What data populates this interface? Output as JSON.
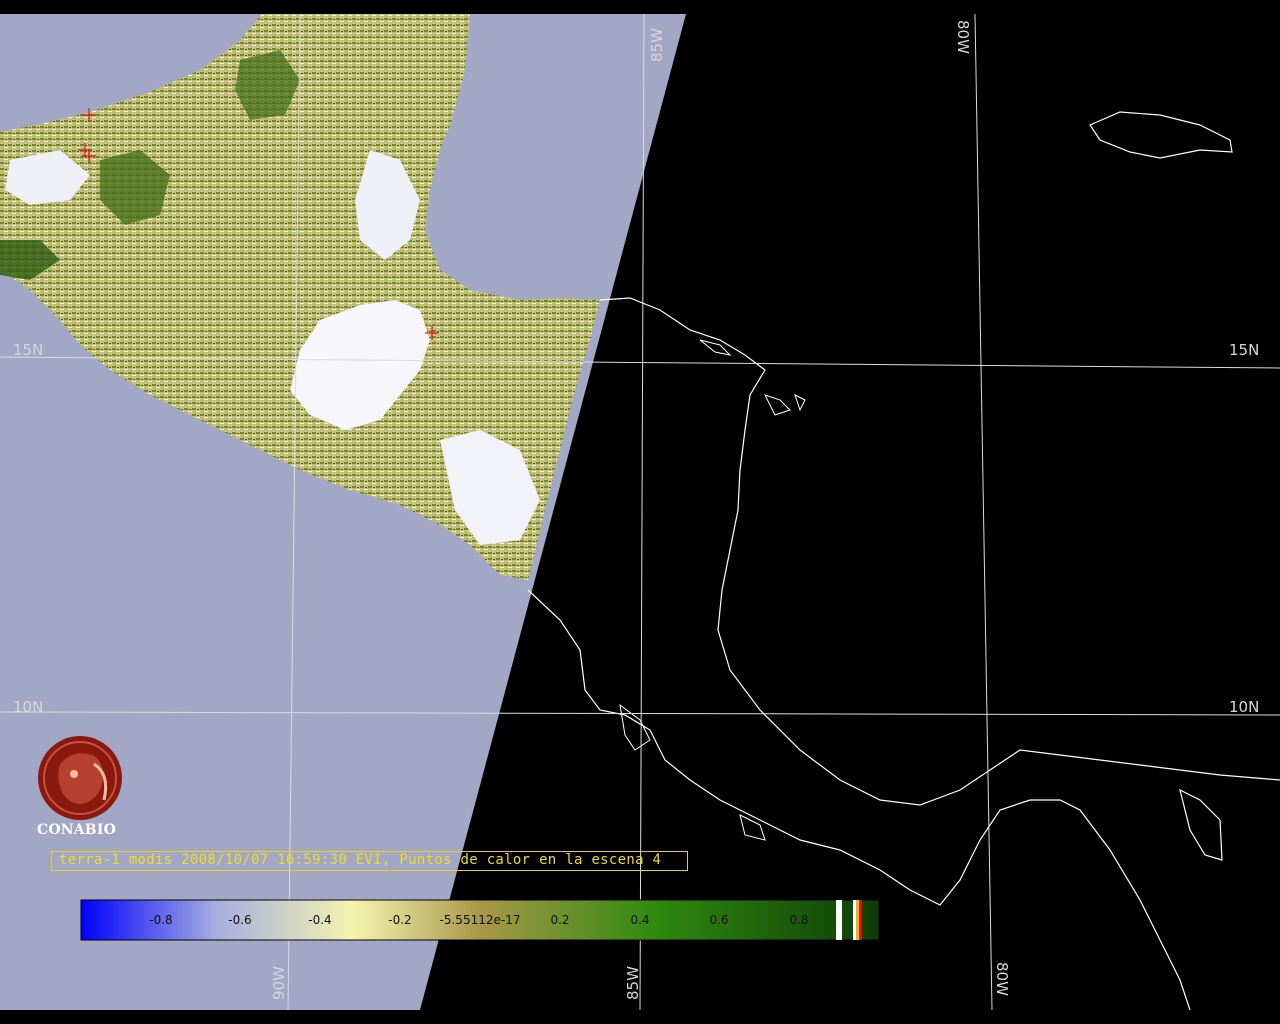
{
  "map": {
    "latitude_labels": [
      "15N",
      "10N"
    ],
    "longitude_labels": [
      "90W",
      "85W",
      "80W"
    ],
    "markers": [
      {
        "name": "hotspot-1"
      },
      {
        "name": "hotspot-2"
      },
      {
        "name": "hotspot-3"
      },
      {
        "name": "hotspot-4"
      }
    ]
  },
  "caption": "terra-1 modis 2008/10/07 16:59:30 EVI, Puntos de calor en la escena 4",
  "logo": {
    "text": "CONABIO"
  },
  "colorbar": {
    "tick_labels": [
      "-0.8",
      "-0.6",
      "-0.4",
      "-0.2",
      "-5.55112e-17",
      "0.2",
      "0.4",
      "0.6",
      "0.8"
    ],
    "stops": [
      "#0000ff",
      "#a8aee0",
      "#f4f4b0",
      "#a89848",
      "#2f8a10",
      "#0e3d08"
    ]
  },
  "colors": {
    "ocean_day": "#a2a7c6",
    "night_side": "#000000",
    "coastline": "#ffffff",
    "vegetation": "#7a9a20",
    "hotspot": "#e01010",
    "caption": "#f0dc20"
  }
}
